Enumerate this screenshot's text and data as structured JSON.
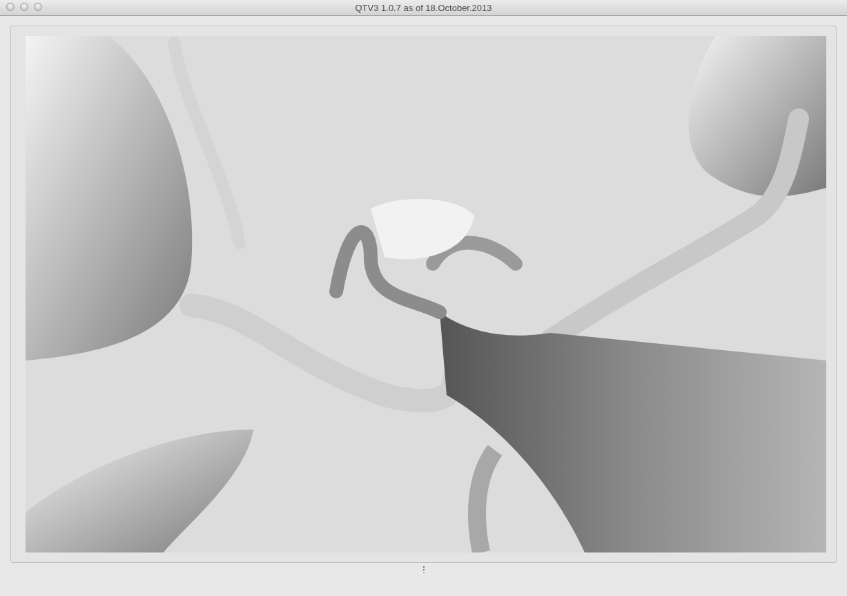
{
  "window": {
    "title": "QTV3 1.0.7 as of 18.October.2013"
  }
}
